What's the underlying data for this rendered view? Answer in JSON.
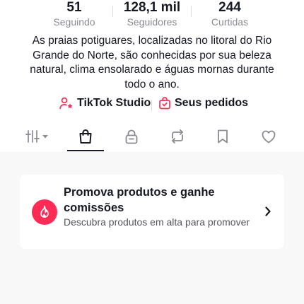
{
  "stats": [
    {
      "value": "51",
      "label": "Seguindo"
    },
    {
      "value": "128,1 mil",
      "label": "Seguidores"
    },
    {
      "value": "244",
      "label": "Curtidas"
    }
  ],
  "bio": "As praias potiguares, localizadas no litoral do Rio Grande do Norte, são conhecidas por sua beleza natural, clima ensolarado e águas mornas durante todo o ano.",
  "links": {
    "studio": "TikTok Studio",
    "orders": "Seus pedidos"
  },
  "tabs": [
    {
      "icon": "grid-menu-icon",
      "active": false
    },
    {
      "icon": "shopping-bag-icon",
      "active": true
    },
    {
      "icon": "lock-icon",
      "active": false
    },
    {
      "icon": "repost-icon",
      "active": false
    },
    {
      "icon": "bookmark-icon",
      "active": false
    },
    {
      "icon": "heart-icon",
      "active": false
    }
  ],
  "promo_card": {
    "title": "Promova produtos e ganhe comissões",
    "subtitle": "Descubra produtos em alta para promover",
    "icon": "flame-icon"
  },
  "colors": {
    "accent": "#fe2c55",
    "text": "#161823",
    "muted": "#8a8b91",
    "content_bg": "#f8f8f8"
  }
}
